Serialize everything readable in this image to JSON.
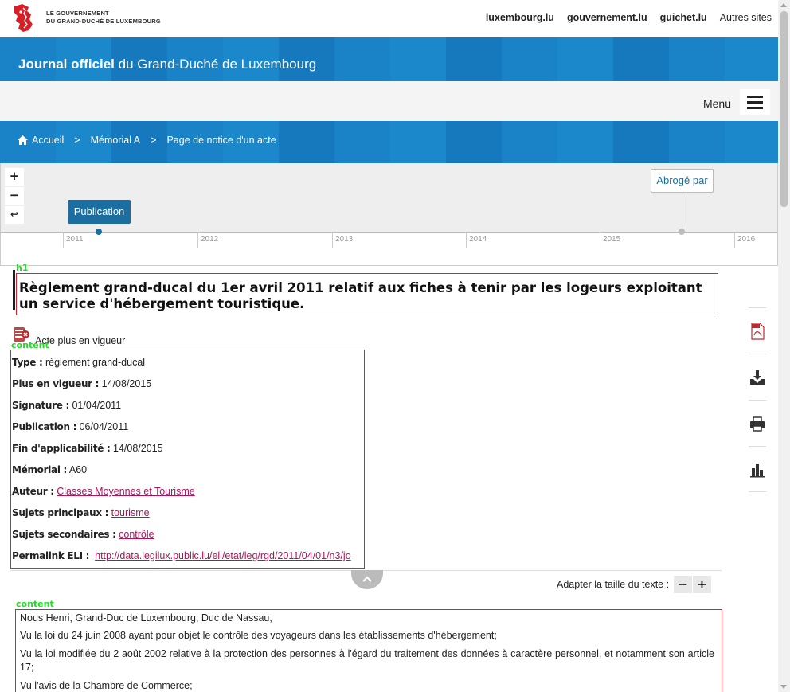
{
  "header": {
    "gov_line_1": "LE GOUVERNEMENT",
    "gov_line_2": "DU GRAND-DUCHÉ DE LUXEMBOURG",
    "links": [
      "luxembourg.lu",
      "gouvernement.lu",
      "guichet.lu"
    ],
    "other_sites": "Autres sites"
  },
  "banner": {
    "title_bold": "Journal officiel",
    "title_rest": " du Grand-Duché de Luxembourg"
  },
  "menu": {
    "label": "Menu",
    "icon": "hamburger-icon"
  },
  "breadcrumb": {
    "items": [
      "Accueil",
      "Mémorial A",
      "Page de notice d'un acte"
    ],
    "separator": ">"
  },
  "timeline": {
    "zoom_in": "+",
    "zoom_out": "−",
    "reset": "↩",
    "years": [
      "2011",
      "2012",
      "2013",
      "2014",
      "2015",
      "2016"
    ],
    "events": [
      {
        "label": "Publication",
        "date": "2011-04-06",
        "color": "#1c6ea0"
      },
      {
        "label": "Abrogé par",
        "date": "2015-08-14",
        "color": "#bbbbbb"
      }
    ]
  },
  "annotations": {
    "h1": "h1",
    "content": "content"
  },
  "act": {
    "title": "Règlement grand-ducal du 1er avril 2011 relatif aux fiches à tenir par les logeurs exploitant un service d'hébergement touristique.",
    "status": "Acte plus en vigueur",
    "meta": [
      {
        "label": "Type :",
        "value": "règlement grand-ducal"
      },
      {
        "label": "Plus en vigueur :",
        "value": "14/08/2015"
      },
      {
        "label": "Signature :",
        "value": "01/04/2011"
      },
      {
        "label": "Publication :",
        "value": "06/04/2011"
      },
      {
        "label": "Fin d'applicabilité :",
        "value": "14/08/2015"
      },
      {
        "label": "Mémorial :",
        "value": "A60"
      },
      {
        "label": "Auteur :",
        "link": "Classes Moyennes et Tourisme"
      },
      {
        "label": "Sujets principaux :",
        "link": "tourisme"
      },
      {
        "label": "Sujets secondaires :",
        "link": "contrôle"
      },
      {
        "label": "Permalink ELI :",
        "link": "http://data.legilux.public.lu/eli/etat/leg/rgd/2011/04/01/n3/jo"
      }
    ]
  },
  "tools": [
    "pdf-icon",
    "download-icon",
    "print-icon",
    "stats-icon"
  ],
  "text_size": {
    "label": "Adapter la taille du texte :",
    "minus": "−",
    "plus": "+"
  },
  "body_paragraphs": [
    "Nous Henri, Grand-Duc de Luxembourg, Duc de Nassau,",
    "Vu la loi du 24 juin 2008 ayant pour objet le contrôle des voyageurs dans les établissements d'hébergement;",
    "Vu la loi modifiée du 2 août 2002 relative à la protection des personnes à l'égard du traitement des données à caractère personnel, et notamment son article 17;",
    "Vu l'avis de la Chambre de Commerce;"
  ],
  "colors": {
    "brand_blue": "#1a82c6",
    "link": "#b0125a",
    "annotation_box": "#e0202a",
    "annotation_label": "#22dd22"
  }
}
